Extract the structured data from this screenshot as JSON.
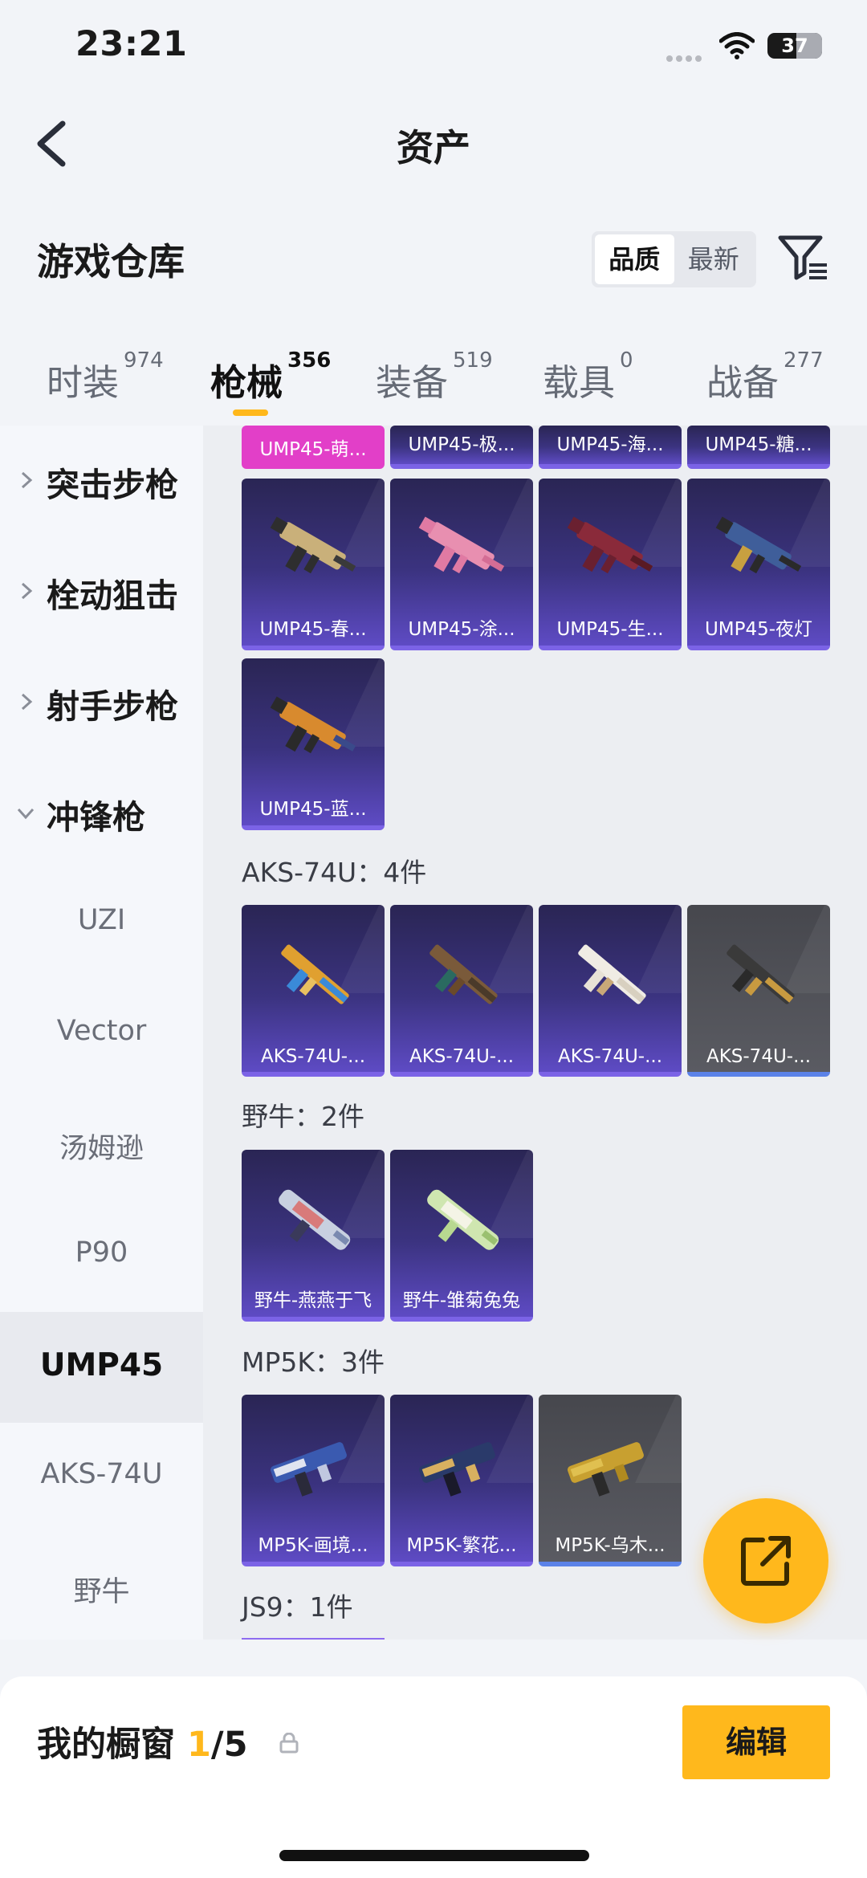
{
  "status_bar": {
    "time": "23:21",
    "battery": "37",
    "icons": [
      "signal-dots-icon",
      "wifi-icon",
      "battery-icon"
    ]
  },
  "nav": {
    "title": "资产",
    "back_icon": "chevron-left-icon"
  },
  "section": {
    "title": "游戏仓库",
    "sort_options": [
      "品质",
      "最新"
    ],
    "active_sort": "品质",
    "filter_icon": "filter-icon"
  },
  "tabs": [
    {
      "label": "时装",
      "count": "974"
    },
    {
      "label": "枪械",
      "count": "356",
      "active": true
    },
    {
      "label": "装备",
      "count": "519"
    },
    {
      "label": "载具",
      "count": "0"
    },
    {
      "label": "战备",
      "count": "277"
    }
  ],
  "sidebar": {
    "categories": [
      {
        "label": "突击步枪",
        "expanded": false
      },
      {
        "label": "栓动狙击",
        "expanded": false
      },
      {
        "label": "射手步枪",
        "expanded": false
      },
      {
        "label": "冲锋枪",
        "expanded": true
      }
    ],
    "subitems": [
      "UZI",
      "Vector",
      "汤姆逊",
      "P90",
      "UMP45",
      "AKS-74U",
      "野牛"
    ],
    "selected": "UMP45"
  },
  "groups": {
    "ump45": {
      "items_top": [
        "UMP45-萌...",
        "UMP45-极...",
        "UMP45-海...",
        "UMP45-糖..."
      ],
      "items": [
        "UMP45-春...",
        "UMP45-涂...",
        "UMP45-生...",
        "UMP45-夜灯",
        "UMP45-蓝..."
      ]
    },
    "aks74u": {
      "title": "AKS-74U：4件",
      "items": [
        "AKS-74U-...",
        "AKS-74U-...",
        "AKS-74U-...",
        "AKS-74U-..."
      ]
    },
    "bizon": {
      "title": "野牛：2件",
      "items": [
        "野牛-燕燕于飞",
        "野牛-雏菊兔兔"
      ]
    },
    "mp5k": {
      "title": "MP5K：3件",
      "items": [
        "MP5K-画境...",
        "MP5K-繁花...",
        "MP5K-乌木..."
      ]
    },
    "js9": {
      "title": "JS9：1件"
    }
  },
  "colors": {
    "accent": "#ffb81c",
    "card_purple": "#3b3380",
    "card_gray": "#55565c",
    "rarity_pink": "#e23fc8"
  },
  "fab": {
    "icon": "share-external-icon"
  },
  "bottom": {
    "label": "我的橱窗",
    "current": "1",
    "total": "/5",
    "lock_icon": "lock-icon",
    "edit_label": "编辑"
  }
}
